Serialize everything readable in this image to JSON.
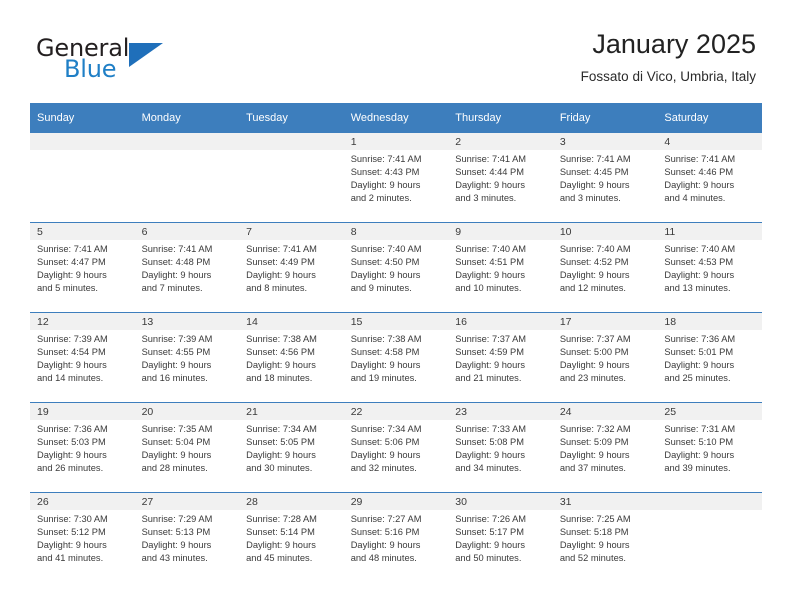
{
  "brand": {
    "word1": "General",
    "word2": "Blue",
    "accent_color": "#1f7fc6",
    "triangle_color": "#1f6fba"
  },
  "header": {
    "title": "January 2025",
    "subtitle": "Fossato di Vico, Umbria, Italy",
    "header_bg": "#3d7ebd"
  },
  "weekday_headers": [
    "Sunday",
    "Monday",
    "Tuesday",
    "Wednesday",
    "Thursday",
    "Friday",
    "Saturday"
  ],
  "weeks": [
    [
      {
        "day": "",
        "sunrise": "",
        "sunset": "",
        "daylight1": "",
        "daylight2": "",
        "empty": true
      },
      {
        "day": "",
        "sunrise": "",
        "sunset": "",
        "daylight1": "",
        "daylight2": "",
        "empty": true
      },
      {
        "day": "",
        "sunrise": "",
        "sunset": "",
        "daylight1": "",
        "daylight2": "",
        "empty": true
      },
      {
        "day": "1",
        "sunrise": "Sunrise: 7:41 AM",
        "sunset": "Sunset: 4:43 PM",
        "daylight1": "Daylight: 9 hours",
        "daylight2": "and 2 minutes."
      },
      {
        "day": "2",
        "sunrise": "Sunrise: 7:41 AM",
        "sunset": "Sunset: 4:44 PM",
        "daylight1": "Daylight: 9 hours",
        "daylight2": "and 3 minutes."
      },
      {
        "day": "3",
        "sunrise": "Sunrise: 7:41 AM",
        "sunset": "Sunset: 4:45 PM",
        "daylight1": "Daylight: 9 hours",
        "daylight2": "and 3 minutes."
      },
      {
        "day": "4",
        "sunrise": "Sunrise: 7:41 AM",
        "sunset": "Sunset: 4:46 PM",
        "daylight1": "Daylight: 9 hours",
        "daylight2": "and 4 minutes."
      }
    ],
    [
      {
        "day": "5",
        "sunrise": "Sunrise: 7:41 AM",
        "sunset": "Sunset: 4:47 PM",
        "daylight1": "Daylight: 9 hours",
        "daylight2": "and 5 minutes."
      },
      {
        "day": "6",
        "sunrise": "Sunrise: 7:41 AM",
        "sunset": "Sunset: 4:48 PM",
        "daylight1": "Daylight: 9 hours",
        "daylight2": "and 7 minutes."
      },
      {
        "day": "7",
        "sunrise": "Sunrise: 7:41 AM",
        "sunset": "Sunset: 4:49 PM",
        "daylight1": "Daylight: 9 hours",
        "daylight2": "and 8 minutes."
      },
      {
        "day": "8",
        "sunrise": "Sunrise: 7:40 AM",
        "sunset": "Sunset: 4:50 PM",
        "daylight1": "Daylight: 9 hours",
        "daylight2": "and 9 minutes."
      },
      {
        "day": "9",
        "sunrise": "Sunrise: 7:40 AM",
        "sunset": "Sunset: 4:51 PM",
        "daylight1": "Daylight: 9 hours",
        "daylight2": "and 10 minutes."
      },
      {
        "day": "10",
        "sunrise": "Sunrise: 7:40 AM",
        "sunset": "Sunset: 4:52 PM",
        "daylight1": "Daylight: 9 hours",
        "daylight2": "and 12 minutes."
      },
      {
        "day": "11",
        "sunrise": "Sunrise: 7:40 AM",
        "sunset": "Sunset: 4:53 PM",
        "daylight1": "Daylight: 9 hours",
        "daylight2": "and 13 minutes."
      }
    ],
    [
      {
        "day": "12",
        "sunrise": "Sunrise: 7:39 AM",
        "sunset": "Sunset: 4:54 PM",
        "daylight1": "Daylight: 9 hours",
        "daylight2": "and 14 minutes."
      },
      {
        "day": "13",
        "sunrise": "Sunrise: 7:39 AM",
        "sunset": "Sunset: 4:55 PM",
        "daylight1": "Daylight: 9 hours",
        "daylight2": "and 16 minutes."
      },
      {
        "day": "14",
        "sunrise": "Sunrise: 7:38 AM",
        "sunset": "Sunset: 4:56 PM",
        "daylight1": "Daylight: 9 hours",
        "daylight2": "and 18 minutes."
      },
      {
        "day": "15",
        "sunrise": "Sunrise: 7:38 AM",
        "sunset": "Sunset: 4:58 PM",
        "daylight1": "Daylight: 9 hours",
        "daylight2": "and 19 minutes."
      },
      {
        "day": "16",
        "sunrise": "Sunrise: 7:37 AM",
        "sunset": "Sunset: 4:59 PM",
        "daylight1": "Daylight: 9 hours",
        "daylight2": "and 21 minutes."
      },
      {
        "day": "17",
        "sunrise": "Sunrise: 7:37 AM",
        "sunset": "Sunset: 5:00 PM",
        "daylight1": "Daylight: 9 hours",
        "daylight2": "and 23 minutes."
      },
      {
        "day": "18",
        "sunrise": "Sunrise: 7:36 AM",
        "sunset": "Sunset: 5:01 PM",
        "daylight1": "Daylight: 9 hours",
        "daylight2": "and 25 minutes."
      }
    ],
    [
      {
        "day": "19",
        "sunrise": "Sunrise: 7:36 AM",
        "sunset": "Sunset: 5:03 PM",
        "daylight1": "Daylight: 9 hours",
        "daylight2": "and 26 minutes."
      },
      {
        "day": "20",
        "sunrise": "Sunrise: 7:35 AM",
        "sunset": "Sunset: 5:04 PM",
        "daylight1": "Daylight: 9 hours",
        "daylight2": "and 28 minutes."
      },
      {
        "day": "21",
        "sunrise": "Sunrise: 7:34 AM",
        "sunset": "Sunset: 5:05 PM",
        "daylight1": "Daylight: 9 hours",
        "daylight2": "and 30 minutes."
      },
      {
        "day": "22",
        "sunrise": "Sunrise: 7:34 AM",
        "sunset": "Sunset: 5:06 PM",
        "daylight1": "Daylight: 9 hours",
        "daylight2": "and 32 minutes."
      },
      {
        "day": "23",
        "sunrise": "Sunrise: 7:33 AM",
        "sunset": "Sunset: 5:08 PM",
        "daylight1": "Daylight: 9 hours",
        "daylight2": "and 34 minutes."
      },
      {
        "day": "24",
        "sunrise": "Sunrise: 7:32 AM",
        "sunset": "Sunset: 5:09 PM",
        "daylight1": "Daylight: 9 hours",
        "daylight2": "and 37 minutes."
      },
      {
        "day": "25",
        "sunrise": "Sunrise: 7:31 AM",
        "sunset": "Sunset: 5:10 PM",
        "daylight1": "Daylight: 9 hours",
        "daylight2": "and 39 minutes."
      }
    ],
    [
      {
        "day": "26",
        "sunrise": "Sunrise: 7:30 AM",
        "sunset": "Sunset: 5:12 PM",
        "daylight1": "Daylight: 9 hours",
        "daylight2": "and 41 minutes."
      },
      {
        "day": "27",
        "sunrise": "Sunrise: 7:29 AM",
        "sunset": "Sunset: 5:13 PM",
        "daylight1": "Daylight: 9 hours",
        "daylight2": "and 43 minutes."
      },
      {
        "day": "28",
        "sunrise": "Sunrise: 7:28 AM",
        "sunset": "Sunset: 5:14 PM",
        "daylight1": "Daylight: 9 hours",
        "daylight2": "and 45 minutes."
      },
      {
        "day": "29",
        "sunrise": "Sunrise: 7:27 AM",
        "sunset": "Sunset: 5:16 PM",
        "daylight1": "Daylight: 9 hours",
        "daylight2": "and 48 minutes."
      },
      {
        "day": "30",
        "sunrise": "Sunrise: 7:26 AM",
        "sunset": "Sunset: 5:17 PM",
        "daylight1": "Daylight: 9 hours",
        "daylight2": "and 50 minutes."
      },
      {
        "day": "31",
        "sunrise": "Sunrise: 7:25 AM",
        "sunset": "Sunset: 5:18 PM",
        "daylight1": "Daylight: 9 hours",
        "daylight2": "and 52 minutes."
      },
      {
        "day": "",
        "sunrise": "",
        "sunset": "",
        "daylight1": "",
        "daylight2": "",
        "empty": true
      }
    ]
  ]
}
